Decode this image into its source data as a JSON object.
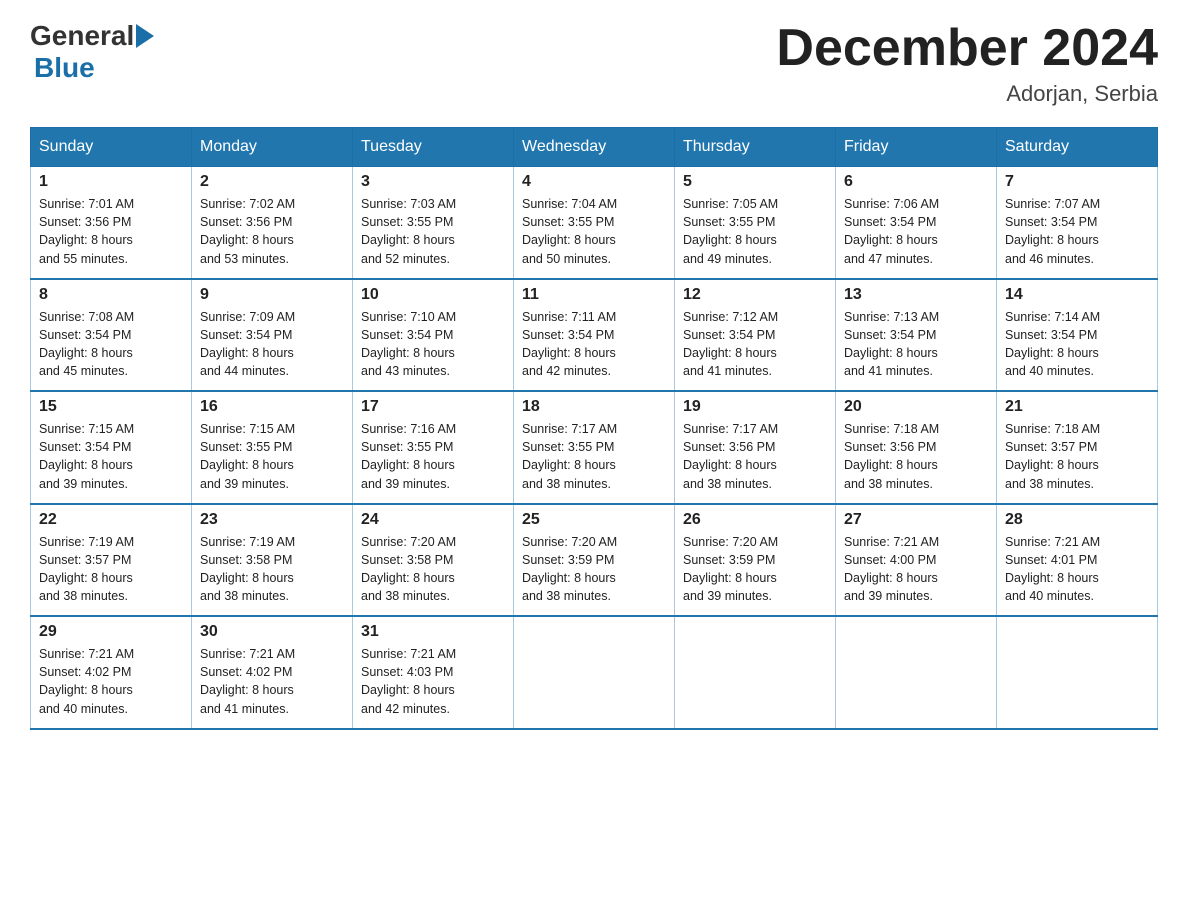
{
  "header": {
    "logo_general": "General",
    "logo_blue": "Blue",
    "month_title": "December 2024",
    "location": "Adorjan, Serbia"
  },
  "weekdays": [
    "Sunday",
    "Monday",
    "Tuesday",
    "Wednesday",
    "Thursday",
    "Friday",
    "Saturday"
  ],
  "weeks": [
    [
      {
        "day": "1",
        "sunrise": "7:01 AM",
        "sunset": "3:56 PM",
        "daylight": "8 hours and 55 minutes."
      },
      {
        "day": "2",
        "sunrise": "7:02 AM",
        "sunset": "3:56 PM",
        "daylight": "8 hours and 53 minutes."
      },
      {
        "day": "3",
        "sunrise": "7:03 AM",
        "sunset": "3:55 PM",
        "daylight": "8 hours and 52 minutes."
      },
      {
        "day": "4",
        "sunrise": "7:04 AM",
        "sunset": "3:55 PM",
        "daylight": "8 hours and 50 minutes."
      },
      {
        "day": "5",
        "sunrise": "7:05 AM",
        "sunset": "3:55 PM",
        "daylight": "8 hours and 49 minutes."
      },
      {
        "day": "6",
        "sunrise": "7:06 AM",
        "sunset": "3:54 PM",
        "daylight": "8 hours and 47 minutes."
      },
      {
        "day": "7",
        "sunrise": "7:07 AM",
        "sunset": "3:54 PM",
        "daylight": "8 hours and 46 minutes."
      }
    ],
    [
      {
        "day": "8",
        "sunrise": "7:08 AM",
        "sunset": "3:54 PM",
        "daylight": "8 hours and 45 minutes."
      },
      {
        "day": "9",
        "sunrise": "7:09 AM",
        "sunset": "3:54 PM",
        "daylight": "8 hours and 44 minutes."
      },
      {
        "day": "10",
        "sunrise": "7:10 AM",
        "sunset": "3:54 PM",
        "daylight": "8 hours and 43 minutes."
      },
      {
        "day": "11",
        "sunrise": "7:11 AM",
        "sunset": "3:54 PM",
        "daylight": "8 hours and 42 minutes."
      },
      {
        "day": "12",
        "sunrise": "7:12 AM",
        "sunset": "3:54 PM",
        "daylight": "8 hours and 41 minutes."
      },
      {
        "day": "13",
        "sunrise": "7:13 AM",
        "sunset": "3:54 PM",
        "daylight": "8 hours and 41 minutes."
      },
      {
        "day": "14",
        "sunrise": "7:14 AM",
        "sunset": "3:54 PM",
        "daylight": "8 hours and 40 minutes."
      }
    ],
    [
      {
        "day": "15",
        "sunrise": "7:15 AM",
        "sunset": "3:54 PM",
        "daylight": "8 hours and 39 minutes."
      },
      {
        "day": "16",
        "sunrise": "7:15 AM",
        "sunset": "3:55 PM",
        "daylight": "8 hours and 39 minutes."
      },
      {
        "day": "17",
        "sunrise": "7:16 AM",
        "sunset": "3:55 PM",
        "daylight": "8 hours and 39 minutes."
      },
      {
        "day": "18",
        "sunrise": "7:17 AM",
        "sunset": "3:55 PM",
        "daylight": "8 hours and 38 minutes."
      },
      {
        "day": "19",
        "sunrise": "7:17 AM",
        "sunset": "3:56 PM",
        "daylight": "8 hours and 38 minutes."
      },
      {
        "day": "20",
        "sunrise": "7:18 AM",
        "sunset": "3:56 PM",
        "daylight": "8 hours and 38 minutes."
      },
      {
        "day": "21",
        "sunrise": "7:18 AM",
        "sunset": "3:57 PM",
        "daylight": "8 hours and 38 minutes."
      }
    ],
    [
      {
        "day": "22",
        "sunrise": "7:19 AM",
        "sunset": "3:57 PM",
        "daylight": "8 hours and 38 minutes."
      },
      {
        "day": "23",
        "sunrise": "7:19 AM",
        "sunset": "3:58 PM",
        "daylight": "8 hours and 38 minutes."
      },
      {
        "day": "24",
        "sunrise": "7:20 AM",
        "sunset": "3:58 PM",
        "daylight": "8 hours and 38 minutes."
      },
      {
        "day": "25",
        "sunrise": "7:20 AM",
        "sunset": "3:59 PM",
        "daylight": "8 hours and 38 minutes."
      },
      {
        "day": "26",
        "sunrise": "7:20 AM",
        "sunset": "3:59 PM",
        "daylight": "8 hours and 39 minutes."
      },
      {
        "day": "27",
        "sunrise": "7:21 AM",
        "sunset": "4:00 PM",
        "daylight": "8 hours and 39 minutes."
      },
      {
        "day": "28",
        "sunrise": "7:21 AM",
        "sunset": "4:01 PM",
        "daylight": "8 hours and 40 minutes."
      }
    ],
    [
      {
        "day": "29",
        "sunrise": "7:21 AM",
        "sunset": "4:02 PM",
        "daylight": "8 hours and 40 minutes."
      },
      {
        "day": "30",
        "sunrise": "7:21 AM",
        "sunset": "4:02 PM",
        "daylight": "8 hours and 41 minutes."
      },
      {
        "day": "31",
        "sunrise": "7:21 AM",
        "sunset": "4:03 PM",
        "daylight": "8 hours and 42 minutes."
      },
      null,
      null,
      null,
      null
    ]
  ],
  "labels": {
    "sunrise": "Sunrise: ",
    "sunset": "Sunset: ",
    "daylight": "Daylight: "
  }
}
